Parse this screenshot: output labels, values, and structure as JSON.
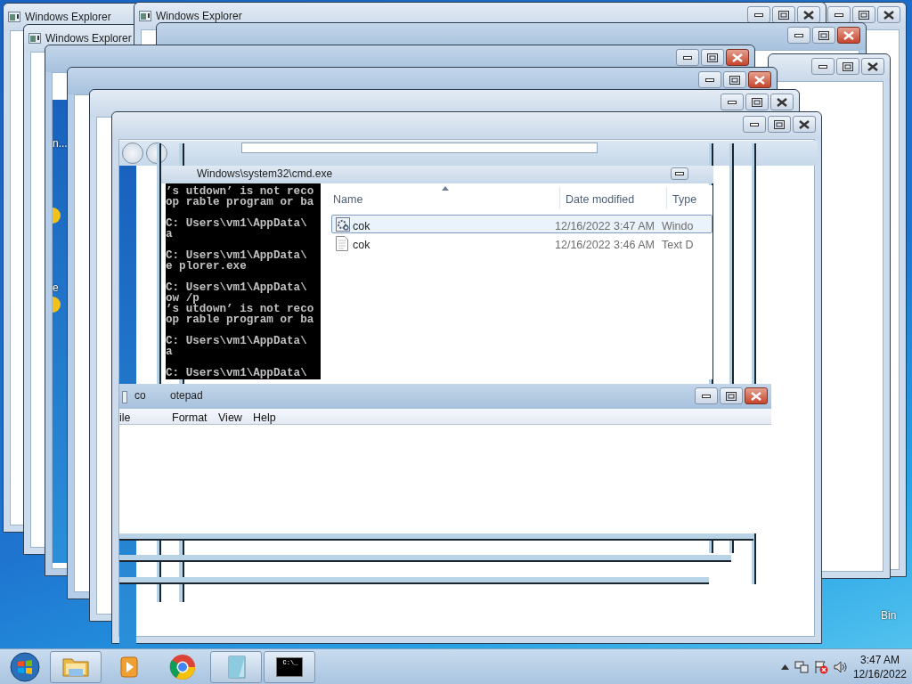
{
  "desktop": {
    "labels": [
      "n...",
      "e",
      "Bin"
    ]
  },
  "windows": [
    {
      "title": "Windows Explorer"
    },
    {
      "buttons": {
        "hot": false
      }
    },
    {
      "title": "Windows Explorer"
    },
    {
      "title": "Windows Explorer",
      "buttons": {
        "hot": false
      }
    },
    {
      "buttons": {
        "hot": true
      }
    },
    {
      "buttons": {
        "hot": true
      }
    },
    {
      "buttons": {
        "hot": false
      }
    },
    {
      "buttons": {
        "hot": true
      }
    },
    {
      "buttons": {
        "hot": false
      }
    },
    {
      "buttons": {
        "hot": false
      }
    }
  ],
  "cmd": {
    "title": "Windows\\system32\\cmd.exe",
    "blocks": [
      [
        "’s utdown’ is not reco",
        "op rable program or ba"
      ],
      [
        "C: Users\\vm1\\AppData\\",
        "a"
      ],
      [
        "C: Users\\vm1\\AppData\\",
        "e plorer.exe"
      ],
      [
        "C: Users\\vm1\\AppData\\",
        "ow /p",
        "’s utdown’ is not reco",
        "op rable program or ba"
      ],
      [
        "C: Users\\vm1\\AppData\\",
        "a"
      ],
      [
        "C: Users\\vm1\\AppData\\"
      ]
    ]
  },
  "explorer": {
    "columns": [
      "Name",
      "Date modified",
      "Type"
    ],
    "rows": [
      {
        "name": "cok",
        "date": "12/16/2022 3:47 AM",
        "type": "Windo",
        "kind": "program",
        "selected": true
      },
      {
        "name": "cok",
        "date": "12/16/2022 3:46 AM",
        "type": "Text D",
        "kind": "text",
        "selected": false
      }
    ]
  },
  "notepad": {
    "title_parts": [
      "co",
      "otepad"
    ],
    "menu": [
      "ile",
      "Format",
      "View",
      "Help"
    ]
  },
  "taskbar": {
    "items": [
      {
        "kind": "folder",
        "open": true
      },
      {
        "kind": "media",
        "open": false
      },
      {
        "kind": "browser",
        "open": false
      },
      {
        "kind": "notepad",
        "open": true
      },
      {
        "kind": "console",
        "open": true,
        "label": "C:\\_"
      }
    ],
    "time": "3:47 AM",
    "date": "12/16/2022"
  }
}
